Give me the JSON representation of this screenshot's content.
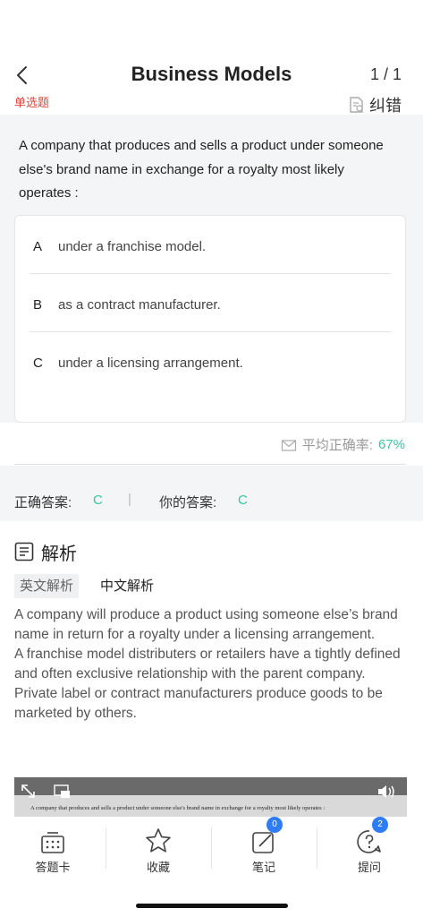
{
  "header": {
    "title": "Business Models",
    "progress": "1 / 1",
    "question_type": "单选题",
    "report_label": "纠错"
  },
  "question": {
    "text": "A company that produces and sells a product under someone else's brand name in exchange for a royalty most likely operates :",
    "options": [
      {
        "letter": "A",
        "text": "under a franchise model."
      },
      {
        "letter": "B",
        "text": "as a contract manufacturer."
      },
      {
        "letter": "C",
        "text": "under a licensing arrangement."
      }
    ]
  },
  "stats": {
    "label": "平均正确率:",
    "accuracy": "67%"
  },
  "answers": {
    "correct_label": "正确答案:",
    "correct_value": "C",
    "yours_label": "你的答案:",
    "yours_value": "C",
    "separator": "|"
  },
  "analysis": {
    "title": "解析",
    "tabs": [
      {
        "label": "英文解析",
        "active": true
      },
      {
        "label": "中文解析",
        "active": false
      }
    ],
    "paragraphs": [
      "A company will produce a product using someone else’s brand name in return for a royalty under a licensing arrangement.",
      "A franchise model distributers or retailers have a tightly defined and often exclusive relationship with the parent company.",
      "Private label or contract manufacturers produce goods to be marketed by others."
    ],
    "video_caption": "A company that produces and sells a product under someone else's brand name in exchange for a royalty most likely operates :"
  },
  "tabbar": {
    "items": [
      {
        "label": "答题卡",
        "icon": "answer-card-icon",
        "badge": ""
      },
      {
        "label": "收藏",
        "icon": "star-icon",
        "badge": ""
      },
      {
        "label": "笔记",
        "icon": "note-edit-icon",
        "badge": "0"
      },
      {
        "label": "提问",
        "icon": "question-icon",
        "badge": "2"
      }
    ]
  },
  "colors": {
    "accent_green": "#3cc5a0",
    "question_type_red": "#e0443a",
    "badge_blue": "#2f7df6"
  }
}
